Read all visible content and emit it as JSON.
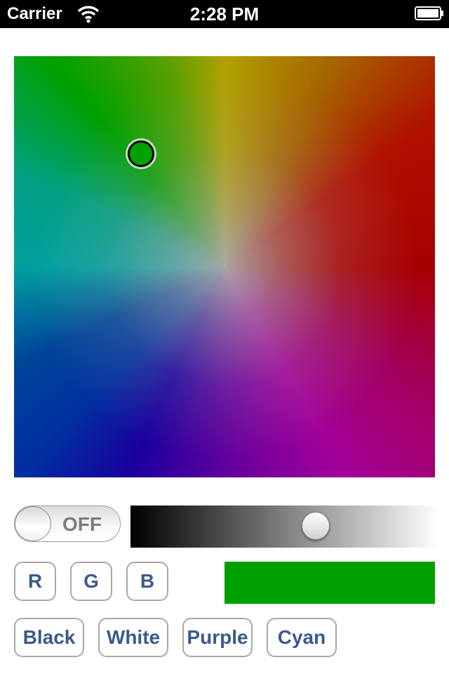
{
  "status_bar": {
    "carrier": "Carrier",
    "time": "2:28 PM",
    "icons": [
      "wifi-icon",
      "battery-icon"
    ]
  },
  "color_picker": {
    "selected_color": "#00a000"
  },
  "controls": {
    "toggle": {
      "label": "OFF",
      "state": "off"
    },
    "brightness_slider": {
      "value": 0.61,
      "gradient_from": "#000000",
      "gradient_to": "#ffffff"
    },
    "channel_buttons": [
      "R",
      "G",
      "B"
    ],
    "color_buttons": [
      "Black",
      "White",
      "Purple",
      "Cyan"
    ],
    "preview_color": "#00a000"
  },
  "colors": {
    "button_text": "#3a5a8a",
    "button_border": "#a8a8a8"
  }
}
